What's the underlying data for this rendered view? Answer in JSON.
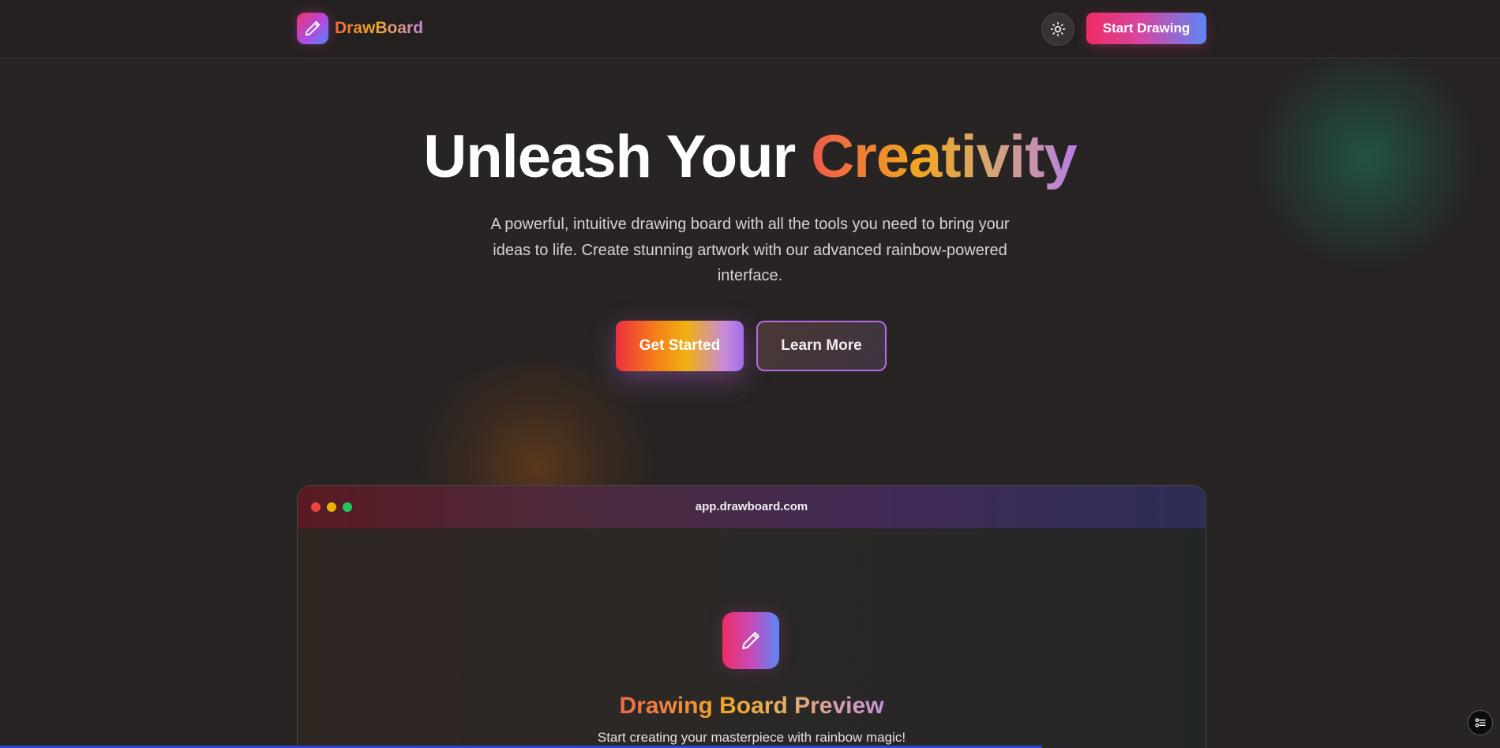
{
  "header": {
    "brand_name": "DrawBoard",
    "logo_icon": "pencil-icon",
    "theme_toggle_icon": "sun-icon",
    "start_drawing_label": "Start Drawing"
  },
  "hero": {
    "title_plain": "Unleash Your ",
    "title_accent": "Creativity",
    "subtitle": "A powerful, intuitive drawing board with all the tools you need to bring your ideas to life. Create stunning artwork with our advanced rainbow-powered interface.",
    "primary_cta": "Get Started",
    "secondary_cta": "Learn More"
  },
  "preview": {
    "url": "app.drawboard.com",
    "icon": "pencil-icon",
    "title": "Drawing Board Preview",
    "subtitle": "Start creating your masterpiece with rainbow magic!"
  },
  "floating_button_icon": "list-settings-icon",
  "colors": {
    "background": "#272423",
    "brand_pink": "#ee2d63",
    "brand_blue": "#5b86f6",
    "accent_purple": "#b36be6",
    "accent_orange": "#f0a520"
  }
}
